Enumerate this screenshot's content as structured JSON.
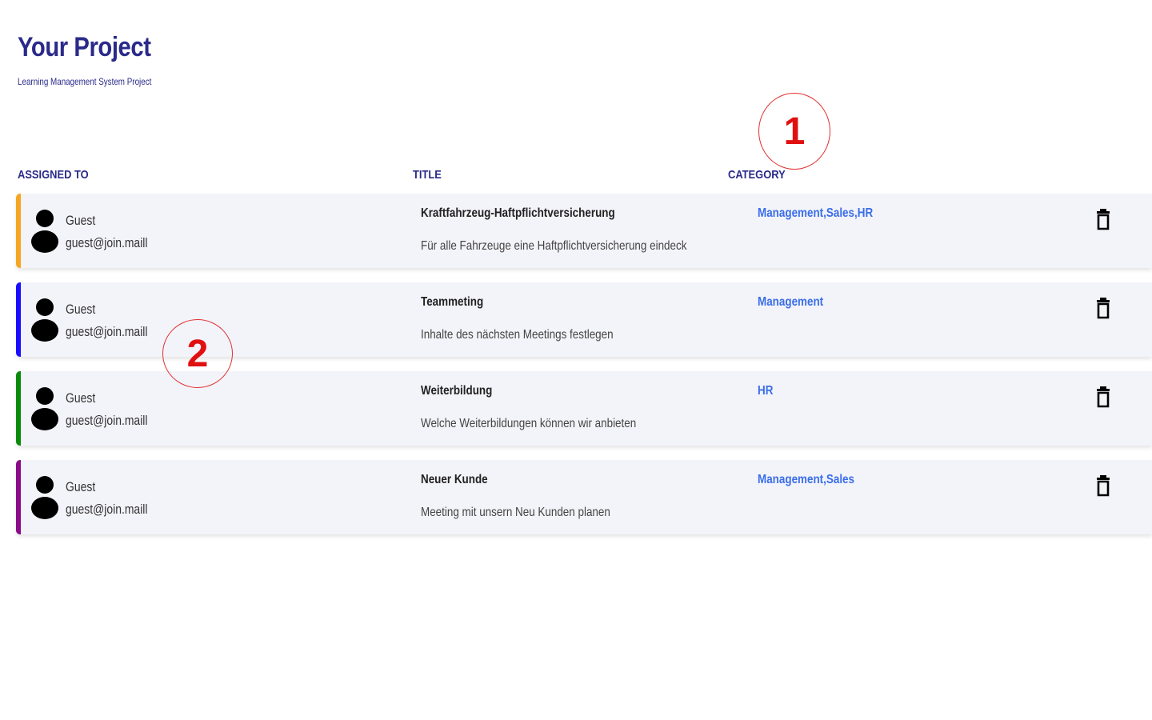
{
  "header": {
    "title": "Your Project",
    "subtitle": "Learning Management System Project"
  },
  "columns": {
    "assigned_to": "ASSIGNED TO",
    "title": "TITLE",
    "category": "CATEGORY"
  },
  "annotations": [
    "1",
    "2"
  ],
  "tasks": [
    {
      "accent_color": "#f5a623",
      "user_name": "Guest",
      "user_email": "guest@join.maill",
      "title": "Kraftfahrzeug-Haftpflichtversicherung",
      "description": "Für alle Fahrzeuge eine Haftpflichtversicherung eindeck",
      "category": "Management,Sales,HR",
      "avatar_icon": "user-icon",
      "delete_icon": "trash-icon"
    },
    {
      "accent_color": "#1a0dff",
      "user_name": "Guest",
      "user_email": "guest@join.maill",
      "title": "Teammeting",
      "description": "Inhalte des nächsten Meetings festlegen",
      "category": "Management",
      "avatar_icon": "user-icon",
      "delete_icon": "trash-icon"
    },
    {
      "accent_color": "#0a8a0a",
      "user_name": "Guest",
      "user_email": "guest@join.maill",
      "title": "Weiterbildung",
      "description": "Welche Weiterbildungen können wir anbieten",
      "category": "HR",
      "avatar_icon": "user-icon",
      "delete_icon": "trash-icon"
    },
    {
      "accent_color": "#8a0a8a",
      "user_name": "Guest",
      "user_email": "guest@join.maill",
      "title": "Neuer Kunde",
      "description": "Meeting mit unsern Neu Kunden planen",
      "category": "Management,Sales",
      "avatar_icon": "user-icon",
      "delete_icon": "trash-icon"
    }
  ]
}
